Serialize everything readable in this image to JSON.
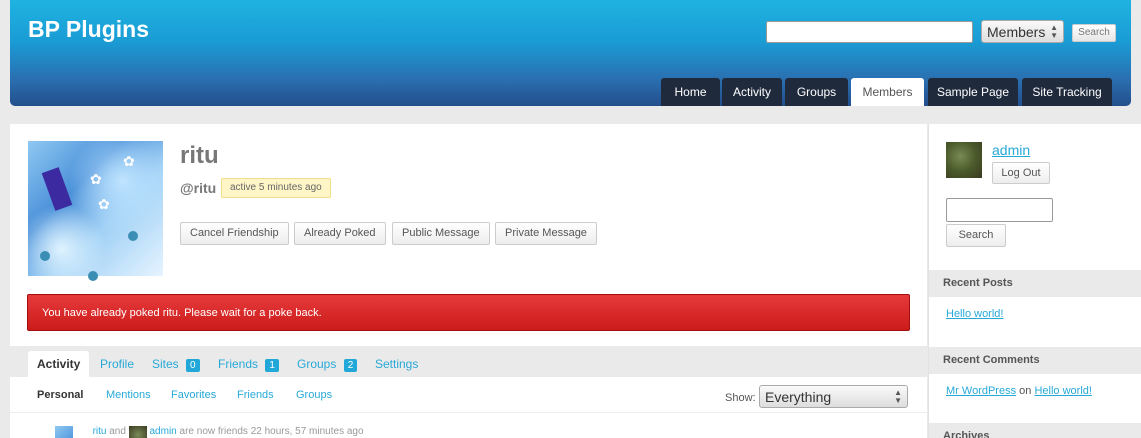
{
  "header": {
    "site_title": "BP Plugins",
    "search_placeholder": "",
    "search_scope": "Members",
    "search_button": "Search",
    "nav": [
      "Home",
      "Activity",
      "Groups",
      "Members",
      "Sample Page",
      "Site Tracking"
    ],
    "active_nav": "Members"
  },
  "profile": {
    "name": "ritu",
    "handle": "@ritu",
    "last_active": "active 5 minutes ago",
    "actions": [
      "Cancel Friendship",
      "Already Poked",
      "Public Message",
      "Private Message"
    ],
    "notice": "You have already poked ritu. Please wait for a poke back."
  },
  "item_nav": {
    "tabs": [
      {
        "label": "Activity",
        "count": ""
      },
      {
        "label": "Profile",
        "count": ""
      },
      {
        "label": "Sites",
        "count": "0"
      },
      {
        "label": "Friends",
        "count": "1"
      },
      {
        "label": "Groups",
        "count": "2"
      },
      {
        "label": "Settings",
        "count": ""
      }
    ]
  },
  "subnav": {
    "tabs": [
      "Personal",
      "Mentions",
      "Favorites",
      "Friends",
      "Groups"
    ],
    "show_label": "Show:",
    "show_value": "Everything"
  },
  "activity": {
    "user1": "ritu",
    "joiner": "and",
    "user2": "admin",
    "text": "are now friends",
    "time": "22 hours, 57 minutes ago"
  },
  "sidebar": {
    "username": "admin",
    "logout": "Log Out",
    "search_button": "Search",
    "recent_posts_title": "Recent Posts",
    "recent_post": "Hello world!",
    "recent_comments_title": "Recent Comments",
    "comment_author": "Mr WordPress",
    "comment_on": "on",
    "comment_post": "Hello world!",
    "archives_title": "Archives"
  },
  "colors": {
    "accent": "#27a9d8",
    "header_dark": "#1f2a3d",
    "notice_red": "#d82828",
    "badge_yellow": "#fff6c8"
  }
}
